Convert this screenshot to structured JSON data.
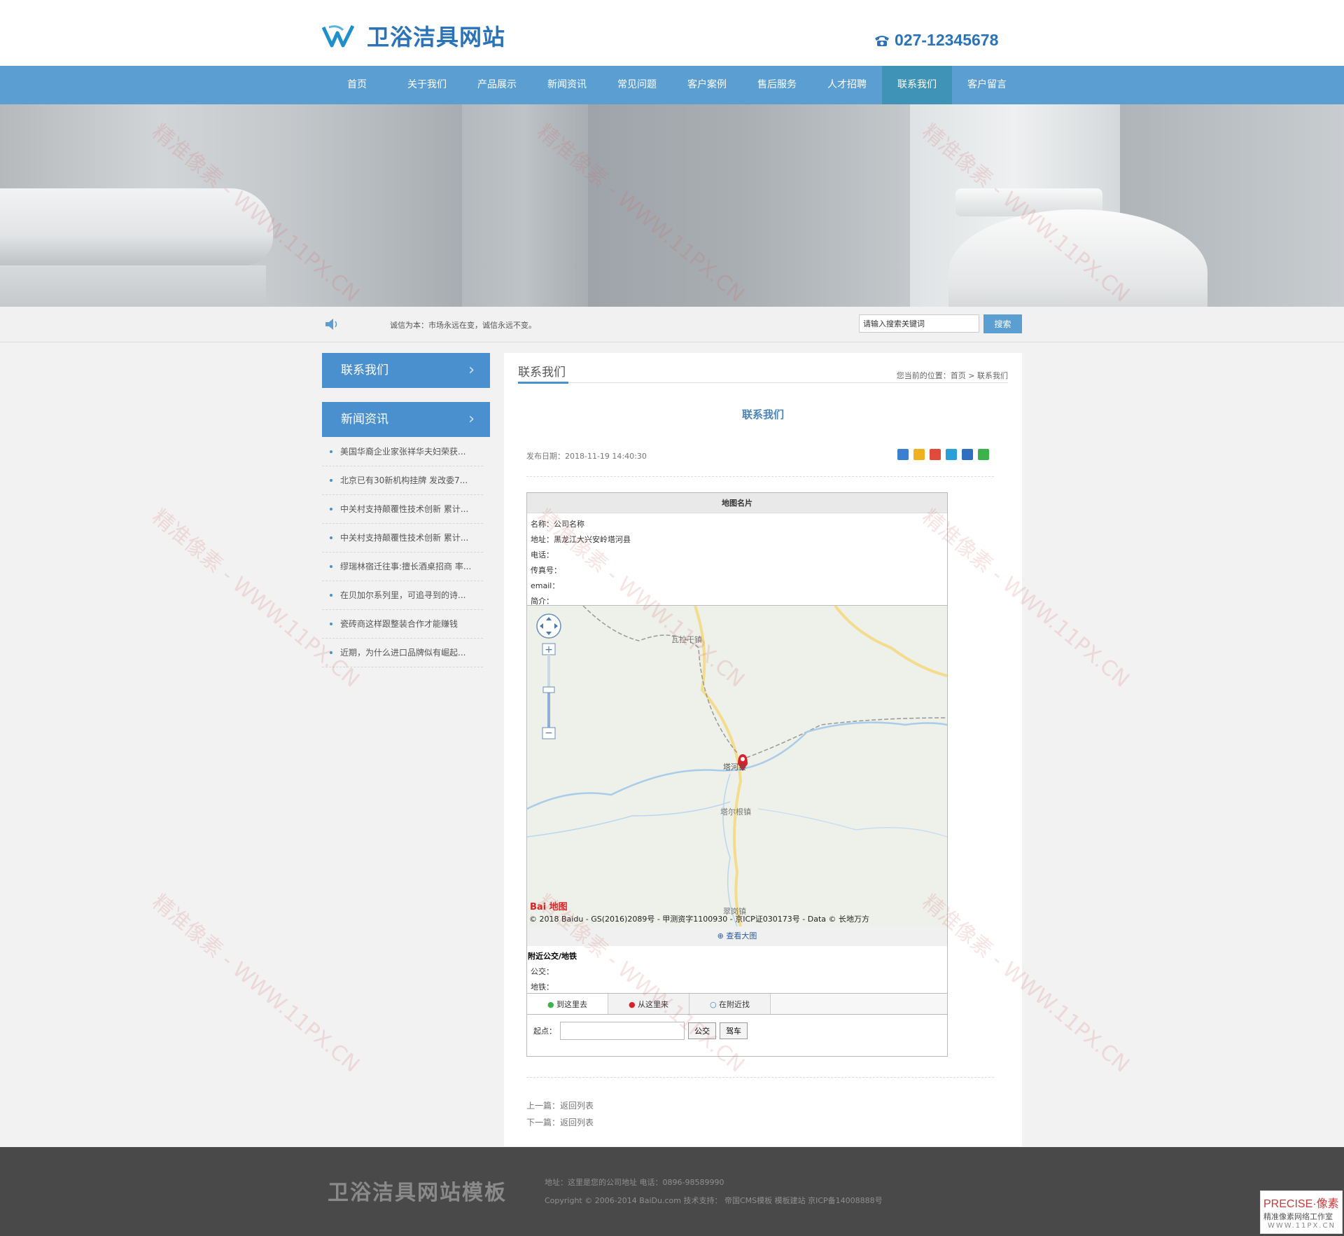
{
  "header": {
    "logo_text": "卫浴洁具网站",
    "phone": "027-12345678"
  },
  "nav": {
    "items": [
      "首页",
      "关于我们",
      "产品展示",
      "新闻资讯",
      "常见问题",
      "客户案例",
      "售后服务",
      "人才招聘",
      "联系我们",
      "客户留言"
    ],
    "active": "联系我们"
  },
  "notice": {
    "text": "诚信为本：市场永远在变，诚信永远不变。",
    "search_placeholder": "请输入搜索关键词",
    "search_button": "搜索"
  },
  "sidebar": {
    "contact_title": "联系我们",
    "news_title": "新闻资讯",
    "news_items": [
      "美国华裔企业家张祥华夫妇荣获...",
      "北京已有30新机构挂牌 发改委7...",
      "中关村支持颠覆性技术创新 累计...",
      "中关村支持颠覆性技术创新 累计...",
      "缪瑞林宿迁往事:擅长酒桌招商 率...",
      "在贝加尔系列里，可追寻到的诗...",
      "瓷砖商这样跟整装合作才能赚钱",
      "近期，为什么进口品牌似有崛起..."
    ]
  },
  "main": {
    "section_title": "联系我们",
    "breadcrumb": "您当前的位置：首页 > 联系我们",
    "article_title": "联系我们",
    "pubdate": "发布日期：2018-11-19 14:40:30",
    "card_title": "地图名片",
    "info": {
      "name": "名称：公司名称",
      "address": "地址：黑龙江大兴安岭塔河县",
      "tel": "电话：",
      "fax": "传真号：",
      "email": "email：",
      "intro": "简介："
    },
    "map": {
      "labels": [
        "瓦拉干镇",
        "塔河县",
        "塔尔根镇",
        "翠岗镇"
      ],
      "copyright": "© 2018 Baidu - GS(2016)2089号 - 甲测资字1100930 - 京ICP证030173号 - Data © 长地万方",
      "logo": "Bai 地图",
      "view_large": "查看大图"
    },
    "nearby": {
      "title": "附近公交/地铁",
      "bus": "公交：",
      "subway": "地铁："
    },
    "tabs": [
      "到这里去",
      "从这里来",
      "在附近找"
    ],
    "route": {
      "start_label": "起点：",
      "bus_button": "公交",
      "car_button": "驾车"
    },
    "prev": "上一篇：返回列表",
    "next": "下一篇：返回列表"
  },
  "footer": {
    "logo": "卫浴洁具网站模板",
    "address": "地址：这里是您的公司地址  电话：0896-98589990",
    "copyright": "Copyright © 2006-2014 BaiDu.com  技术支持： 帝国CMS模板 模板建站 京ICP备14008888号"
  },
  "badge": {
    "line1": "PRECISE·像素",
    "line2": "精准像素网络工作室",
    "line3": "WWW.11PX.CN"
  },
  "watermark": "精准像素 - WWW.11PX.CN",
  "colors": {
    "brand_blue": "#5b9fd2",
    "nav_active": "#3f93b7",
    "side_head": "#4a90cf",
    "footer_bg": "#494949"
  }
}
